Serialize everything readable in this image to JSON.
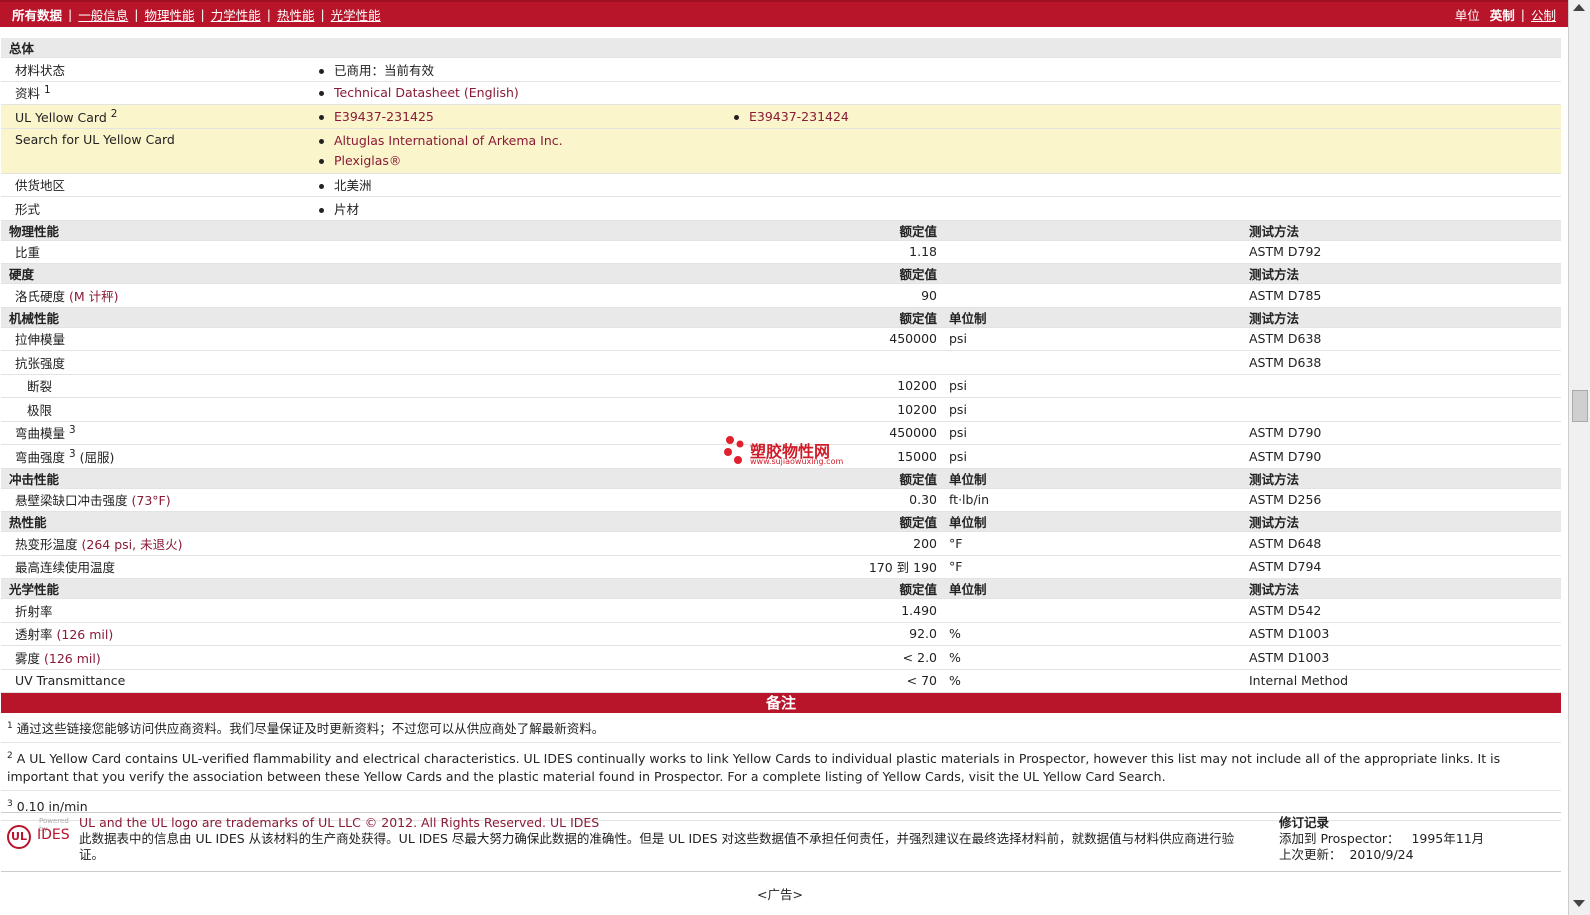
{
  "topbar": {
    "tabs": [
      "所有数据",
      "一般信息",
      "物理性能",
      "力学性能",
      "热性能",
      "光学性能"
    ],
    "units_label": "单位",
    "units": [
      "英制",
      "公制"
    ]
  },
  "general": {
    "header": "总体",
    "material_status_label": "材料状态",
    "material_status_value": "已商用：当前有效",
    "docs_label": "资料",
    "docs_sup": "1",
    "docs_link": "Technical Datasheet (English)",
    "yellow_card_label": "UL Yellow Card",
    "yellow_card_sup": "2",
    "yellow_cards": [
      "E39437-231425",
      "E39437-231424"
    ],
    "search_label": "Search for UL Yellow Card",
    "search_links": [
      "Altuglas International of Arkema Inc.",
      "Plexiglas®"
    ],
    "region_label": "供货地区",
    "region_value": "北美洲",
    "form_label": "形式",
    "form_value": "片材"
  },
  "physical": {
    "header": "物理性能",
    "col_value": "额定值",
    "col_method": "测试方法",
    "rows": [
      {
        "label": "比重",
        "value": "1.18",
        "unit": "",
        "method": "ASTM D792"
      }
    ]
  },
  "hardness": {
    "header": "硬度",
    "col_value": "额定值",
    "col_method": "测试方法",
    "rows": [
      {
        "label": "洛氏硬度",
        "cond": "(M 计秤)",
        "value": "90",
        "unit": "",
        "method": "ASTM D785"
      }
    ]
  },
  "mechanical": {
    "header": "机械性能",
    "col_value": "额定值",
    "col_unit": "单位制",
    "col_method": "测试方法",
    "rows": [
      {
        "label": "拉伸模量",
        "value": "450000",
        "unit": "psi",
        "method": "ASTM D638"
      },
      {
        "label": "抗张强度",
        "value": "",
        "unit": "",
        "method": "ASTM D638"
      },
      {
        "label": "断裂",
        "value": "10200",
        "unit": "psi",
        "method": ""
      },
      {
        "label": "极限",
        "value": "10200",
        "unit": "psi",
        "method": ""
      },
      {
        "label": "弯曲模量",
        "sup": "3",
        "value": "450000",
        "unit": "psi",
        "method": "ASTM D790"
      },
      {
        "label": "弯曲强度",
        "sup": "3",
        "cond": "(屈服)",
        "value": "15000",
        "unit": "psi",
        "method": "ASTM D790"
      }
    ]
  },
  "impact": {
    "header": "冲击性能",
    "col_value": "额定值",
    "col_unit": "单位制",
    "col_method": "测试方法",
    "rows": [
      {
        "label": "悬壁梁缺口冲击强度",
        "cond": "(73°F)",
        "value": "0.30",
        "unit": "ft·lb/in",
        "method": "ASTM D256"
      }
    ]
  },
  "thermal": {
    "header": "热性能",
    "col_value": "额定值",
    "col_unit": "单位制",
    "col_method": "测试方法",
    "rows": [
      {
        "label": "热变形温度",
        "cond": "(264 psi, 未退火)",
        "value": "200",
        "unit": "°F",
        "method": "ASTM D648"
      },
      {
        "label": "最高连续使用温度",
        "value": "170 到  190",
        "unit": "°F",
        "method": "ASTM D794"
      }
    ]
  },
  "optical": {
    "header": "光学性能",
    "col_value": "额定值",
    "col_unit": "单位制",
    "col_method": "测试方法",
    "rows": [
      {
        "label": "折射率",
        "value": "1.490",
        "unit": "",
        "method": "ASTM D542"
      },
      {
        "label": "透射率",
        "cond": "(126 mil)",
        "value": "92.0",
        "unit": "%",
        "method": "ASTM D1003"
      },
      {
        "label": "雾度",
        "cond": "(126 mil)",
        "value": "< 2.0",
        "unit": "%",
        "method": "ASTM D1003"
      },
      {
        "label": "UV Transmittance",
        "value": "< 70",
        "unit": "%",
        "method": "Internal Method"
      }
    ]
  },
  "notes": {
    "header": "备注",
    "items": [
      {
        "num": "1",
        "text": "通过这些链接您能够访问供应商资料。我们尽量保证及时更新资料；不过您可以从供应商处了解最新资料。"
      },
      {
        "num": "2",
        "text": "A UL Yellow Card contains UL-verified flammability and electrical characteristics. UL IDES continually works to link Yellow Cards to individual plastic materials in Prospector, however this list may not include all of the appropriate links. It is important that you verify the association between these Yellow Cards and the plastic material found in Prospector. For a complete listing of Yellow Cards, visit the UL Yellow Card Search."
      },
      {
        "num": "3",
        "text": "0.10 in/min"
      }
    ]
  },
  "footer": {
    "logo_powered": "Powered by",
    "logo_ul": "UL",
    "logo_ides": "IDES",
    "trademark": "UL and the UL logo are trademarks of UL LLC © 2012. All Rights Reserved. UL IDES",
    "disclaimer": "此数据表中的信息由  UL IDES 从该材料的生产商处获得。UL IDES 尽最大努力确保此数据的准确性。但是  UL IDES 对这些数据值不承担任何责任，并强烈建议在最终选择材料前，就数据值与材料供应商进行验证。",
    "revision_title": "修订记录",
    "added_label": "添加到  Prospector：",
    "added_date": "1995年11月",
    "updated_label": "上次更新：",
    "updated_date": "2010/9/24"
  },
  "ad_label": "<广告>",
  "watermark": {
    "title": "塑胶物性网",
    "url": "www.sujiaowuxing.com"
  },
  "colors": {
    "brand": "#b8142a",
    "link": "#8a1a36",
    "section_bg": "#e9e9e9",
    "highlight": "#fbf5cc"
  }
}
